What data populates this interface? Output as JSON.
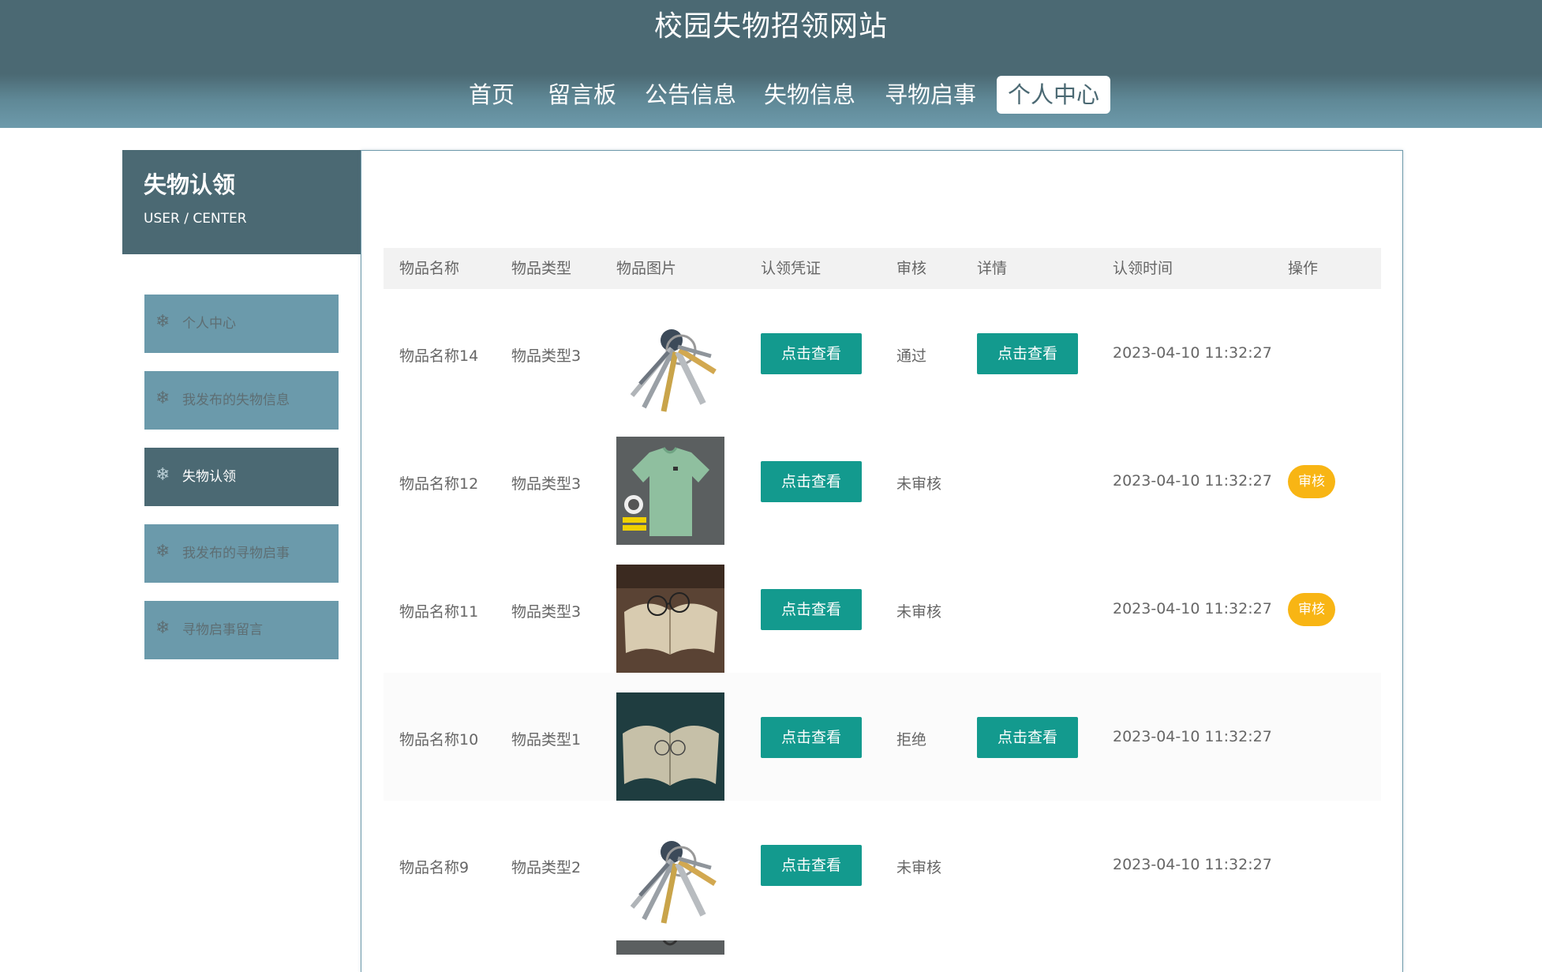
{
  "site": {
    "title": "校园失物招领网站"
  },
  "nav": [
    "首页",
    "留言板",
    "公告信息",
    "失物信息",
    "寻物启事",
    "个人中心"
  ],
  "sidebar": {
    "title": "失物认领",
    "subtitle": "USER / CENTER",
    "items": [
      {
        "label": "个人中心",
        "icon": "snowflake-icon"
      },
      {
        "label": "我发布的失物信息",
        "icon": "snowflake-icon"
      },
      {
        "label": "失物认领",
        "icon": "snowflake-icon",
        "active": true
      },
      {
        "label": "我发布的寻物启事",
        "icon": "snowflake-icon"
      },
      {
        "label": "寻物启事留言",
        "icon": "snowflake-icon"
      }
    ]
  },
  "table": {
    "columns": [
      "物品名称",
      "物品类型",
      "物品图片",
      "认领凭证",
      "审核",
      "详情",
      "认领时间",
      "操作"
    ],
    "view_label": "点击查看",
    "audit_label": "审核",
    "rows": [
      {
        "name": "物品名称14",
        "type": "物品类型3",
        "image": "keys",
        "proof": "点击查看",
        "status": "通过",
        "detail": "点击查看",
        "time": "2023-04-10 11:32:27",
        "action": ""
      },
      {
        "name": "物品名称12",
        "type": "物品类型3",
        "image": "tshirt",
        "proof": "点击查看",
        "status": "未审核",
        "detail": "",
        "time": "2023-04-10 11:32:27",
        "action": "审核"
      },
      {
        "name": "物品名称11",
        "type": "物品类型3",
        "image": "glasses-book",
        "proof": "点击查看",
        "status": "未审核",
        "detail": "",
        "time": "2023-04-10 11:32:27",
        "action": "审核"
      },
      {
        "name": "物品名称10",
        "type": "物品类型1",
        "image": "book",
        "proof": "点击查看",
        "status": "拒绝",
        "detail": "点击查看",
        "time": "2023-04-10 11:32:27",
        "action": ""
      },
      {
        "name": "物品名称9",
        "type": "物品类型2",
        "image": "keys",
        "proof": "点击查看",
        "status": "未审核",
        "detail": "",
        "time": "2023-04-10 11:32:27",
        "action": ""
      }
    ]
  },
  "colors": {
    "header": "#4b6973",
    "sidebar_item": "#6b9aab",
    "view_button": "#139a8e",
    "audit_button": "#f8b514"
  }
}
